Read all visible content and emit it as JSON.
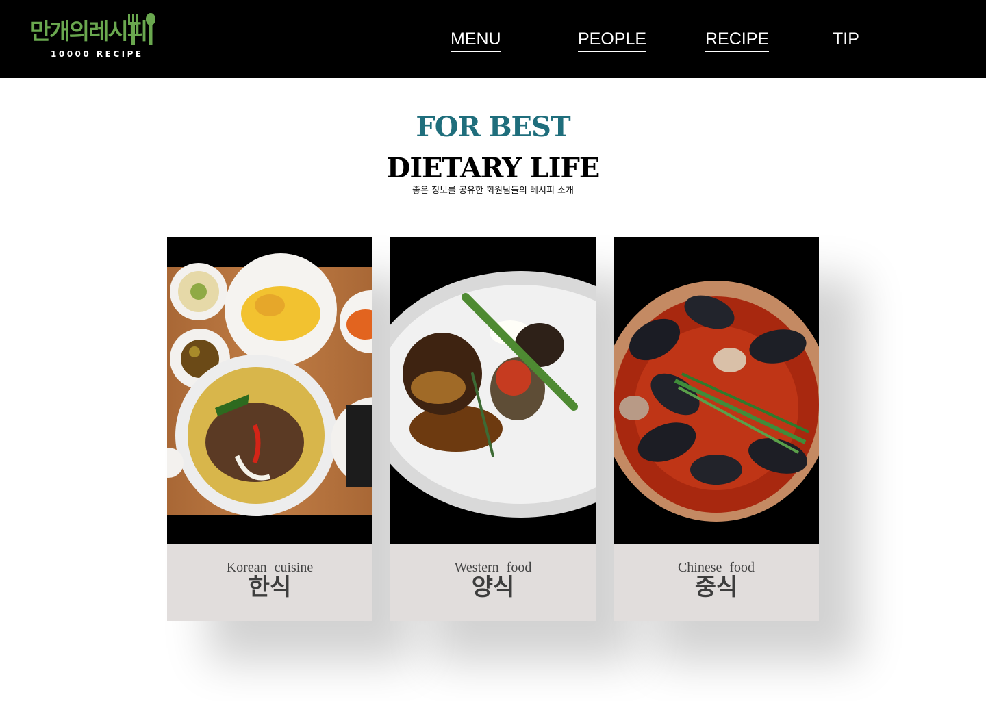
{
  "header": {
    "logo": {
      "title_kr": "만개의레시피",
      "subtitle_en": "10000 RECIPE",
      "brand_color": "#6aa84f"
    },
    "nav": [
      {
        "label": "MENU",
        "underlined": true
      },
      {
        "label": "PEOPLE",
        "underlined": true
      },
      {
        "label": "RECIPE",
        "underlined": true
      },
      {
        "label": "TIP",
        "underlined": false
      }
    ]
  },
  "hero": {
    "kicker": "FOR BEST",
    "title": "DIETARY LIFE",
    "subtitle": "좋은 정보를 공유한 회원님들의  레시피 소개",
    "kicker_color": "#1f6e7c"
  },
  "cards": [
    {
      "label_en": "Korean  cuisine",
      "label_kr": "한식",
      "photo": "korean-table-set-photo"
    },
    {
      "label_en": "Western  food",
      "label_kr": "양식",
      "photo": "steak-plate-photo"
    },
    {
      "label_en": "Chinese  food",
      "label_kr": "중식",
      "photo": "jjamppong-mussels-photo"
    }
  ]
}
